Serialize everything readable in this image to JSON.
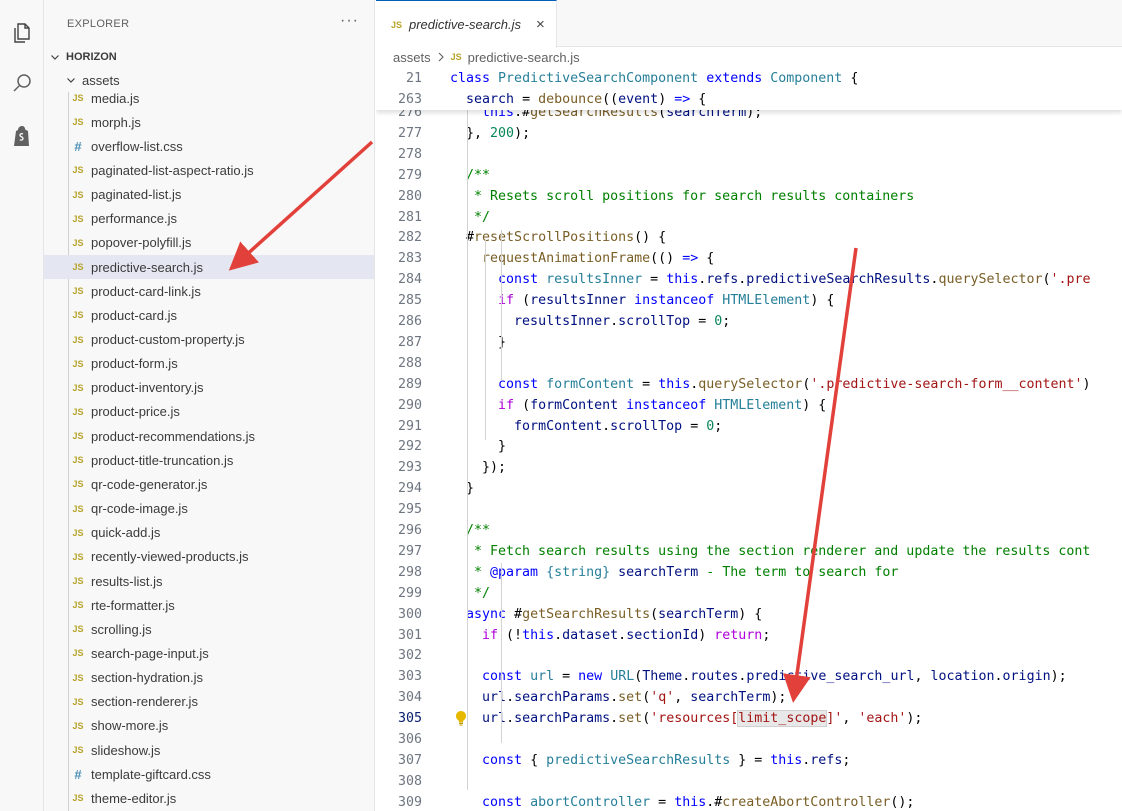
{
  "sidebar": {
    "title": "EXPLORER",
    "more": "···",
    "root": "HORIZON",
    "folder": "assets",
    "files": [
      {
        "name": "media.js",
        "type": "JS"
      },
      {
        "name": "morph.js",
        "type": "JS"
      },
      {
        "name": "overflow-list.css",
        "type": "#"
      },
      {
        "name": "paginated-list-aspect-ratio.js",
        "type": "JS"
      },
      {
        "name": "paginated-list.js",
        "type": "JS"
      },
      {
        "name": "performance.js",
        "type": "JS"
      },
      {
        "name": "popover-polyfill.js",
        "type": "JS"
      },
      {
        "name": "predictive-search.js",
        "type": "JS",
        "selected": true
      },
      {
        "name": "product-card-link.js",
        "type": "JS"
      },
      {
        "name": "product-card.js",
        "type": "JS"
      },
      {
        "name": "product-custom-property.js",
        "type": "JS"
      },
      {
        "name": "product-form.js",
        "type": "JS"
      },
      {
        "name": "product-inventory.js",
        "type": "JS"
      },
      {
        "name": "product-price.js",
        "type": "JS"
      },
      {
        "name": "product-recommendations.js",
        "type": "JS"
      },
      {
        "name": "product-title-truncation.js",
        "type": "JS"
      },
      {
        "name": "qr-code-generator.js",
        "type": "JS"
      },
      {
        "name": "qr-code-image.js",
        "type": "JS"
      },
      {
        "name": "quick-add.js",
        "type": "JS"
      },
      {
        "name": "recently-viewed-products.js",
        "type": "JS"
      },
      {
        "name": "results-list.js",
        "type": "JS"
      },
      {
        "name": "rte-formatter.js",
        "type": "JS"
      },
      {
        "name": "scrolling.js",
        "type": "JS"
      },
      {
        "name": "search-page-input.js",
        "type": "JS"
      },
      {
        "name": "section-hydration.js",
        "type": "JS"
      },
      {
        "name": "section-renderer.js",
        "type": "JS"
      },
      {
        "name": "show-more.js",
        "type": "JS"
      },
      {
        "name": "slideshow.js",
        "type": "JS"
      },
      {
        "name": "template-giftcard.css",
        "type": "#"
      },
      {
        "name": "theme-editor.js",
        "type": "JS"
      }
    ]
  },
  "editor": {
    "tab": {
      "icon": "JS",
      "label": "predictive-search.js",
      "close": "×"
    },
    "breadcrumb": {
      "folder": "assets",
      "icon": "JS",
      "file": "predictive-search.js"
    },
    "sticky_lines": [
      {
        "num": "21",
        "segs": [
          {
            "t": "class ",
            "c": "kw"
          },
          {
            "t": "PredictiveSearchComponent",
            "c": "ty"
          },
          {
            "t": " ",
            "c": ""
          },
          {
            "t": "extends",
            "c": "kw"
          },
          {
            "t": " ",
            "c": ""
          },
          {
            "t": "Component",
            "c": "ty"
          },
          {
            "t": " {",
            "c": ""
          }
        ]
      },
      {
        "num": "263",
        "segs": [
          {
            "t": "  ",
            "c": ""
          },
          {
            "t": "search",
            "c": "vr"
          },
          {
            "t": " = ",
            "c": ""
          },
          {
            "t": "debounce",
            "c": "fn"
          },
          {
            "t": "((",
            "c": ""
          },
          {
            "t": "event",
            "c": "vr"
          },
          {
            "t": ") ",
            "c": ""
          },
          {
            "t": "=>",
            "c": "kw"
          },
          {
            "t": " {",
            "c": ""
          }
        ]
      }
    ],
    "lines": [
      {
        "num": "276",
        "segs": [
          {
            "t": "    ",
            "c": ""
          },
          {
            "t": "this",
            "c": "kw"
          },
          {
            "t": ".#",
            "c": ""
          },
          {
            "t": "getSearchResults",
            "c": "fn"
          },
          {
            "t": "(",
            "c": ""
          },
          {
            "t": "searchTerm",
            "c": "vr"
          },
          {
            "t": ");",
            "c": ""
          }
        ]
      },
      {
        "num": "277",
        "segs": [
          {
            "t": "  }, ",
            "c": ""
          },
          {
            "t": "200",
            "c": "num"
          },
          {
            "t": ");",
            "c": ""
          }
        ]
      },
      {
        "num": "278",
        "segs": []
      },
      {
        "num": "279",
        "segs": [
          {
            "t": "  /**",
            "c": "cm"
          }
        ]
      },
      {
        "num": "280",
        "segs": [
          {
            "t": "   * Resets scroll positions for search results containers",
            "c": "cm"
          }
        ]
      },
      {
        "num": "281",
        "segs": [
          {
            "t": "   */",
            "c": "cm"
          }
        ]
      },
      {
        "num": "282",
        "segs": [
          {
            "t": "  #",
            "c": ""
          },
          {
            "t": "resetScrollPositions",
            "c": "fn"
          },
          {
            "t": "() {",
            "c": ""
          }
        ]
      },
      {
        "num": "283",
        "segs": [
          {
            "t": "    ",
            "c": ""
          },
          {
            "t": "requestAnimationFrame",
            "c": "fn"
          },
          {
            "t": "(() ",
            "c": ""
          },
          {
            "t": "=>",
            "c": "kw"
          },
          {
            "t": " {",
            "c": ""
          }
        ]
      },
      {
        "num": "284",
        "segs": [
          {
            "t": "      ",
            "c": ""
          },
          {
            "t": "const",
            "c": "kw"
          },
          {
            "t": " ",
            "c": ""
          },
          {
            "t": "resultsInner",
            "c": "ty"
          },
          {
            "t": " = ",
            "c": ""
          },
          {
            "t": "this",
            "c": "kw"
          },
          {
            "t": ".",
            "c": ""
          },
          {
            "t": "refs",
            "c": "vr"
          },
          {
            "t": ".",
            "c": ""
          },
          {
            "t": "predictiveSearchResults",
            "c": "vr"
          },
          {
            "t": ".",
            "c": ""
          },
          {
            "t": "querySelector",
            "c": "fn"
          },
          {
            "t": "(",
            "c": ""
          },
          {
            "t": "'.pre",
            "c": "str"
          }
        ]
      },
      {
        "num": "285",
        "segs": [
          {
            "t": "      ",
            "c": ""
          },
          {
            "t": "if",
            "c": "kc"
          },
          {
            "t": " (",
            "c": ""
          },
          {
            "t": "resultsInner",
            "c": "vr"
          },
          {
            "t": " ",
            "c": ""
          },
          {
            "t": "instanceof",
            "c": "kw"
          },
          {
            "t": " ",
            "c": ""
          },
          {
            "t": "HTMLElement",
            "c": "ty"
          },
          {
            "t": ") {",
            "c": ""
          }
        ]
      },
      {
        "num": "286",
        "segs": [
          {
            "t": "        ",
            "c": ""
          },
          {
            "t": "resultsInner",
            "c": "vr"
          },
          {
            "t": ".",
            "c": ""
          },
          {
            "t": "scrollTop",
            "c": "vr"
          },
          {
            "t": " = ",
            "c": ""
          },
          {
            "t": "0",
            "c": "num"
          },
          {
            "t": ";",
            "c": ""
          }
        ]
      },
      {
        "num": "287",
        "segs": [
          {
            "t": "      }",
            "c": ""
          }
        ]
      },
      {
        "num": "288",
        "segs": []
      },
      {
        "num": "289",
        "segs": [
          {
            "t": "      ",
            "c": ""
          },
          {
            "t": "const",
            "c": "kw"
          },
          {
            "t": " ",
            "c": ""
          },
          {
            "t": "formContent",
            "c": "ty"
          },
          {
            "t": " = ",
            "c": ""
          },
          {
            "t": "this",
            "c": "kw"
          },
          {
            "t": ".",
            "c": ""
          },
          {
            "t": "querySelector",
            "c": "fn"
          },
          {
            "t": "(",
            "c": ""
          },
          {
            "t": "'.predictive-search-form__content'",
            "c": "str"
          },
          {
            "t": ")",
            "c": ""
          }
        ]
      },
      {
        "num": "290",
        "segs": [
          {
            "t": "      ",
            "c": ""
          },
          {
            "t": "if",
            "c": "kc"
          },
          {
            "t": " (",
            "c": ""
          },
          {
            "t": "formContent",
            "c": "vr"
          },
          {
            "t": " ",
            "c": ""
          },
          {
            "t": "instanceof",
            "c": "kw"
          },
          {
            "t": " ",
            "c": ""
          },
          {
            "t": "HTMLElement",
            "c": "ty"
          },
          {
            "t": ") {",
            "c": ""
          }
        ]
      },
      {
        "num": "291",
        "segs": [
          {
            "t": "        ",
            "c": ""
          },
          {
            "t": "formContent",
            "c": "vr"
          },
          {
            "t": ".",
            "c": ""
          },
          {
            "t": "scrollTop",
            "c": "vr"
          },
          {
            "t": " = ",
            "c": ""
          },
          {
            "t": "0",
            "c": "num"
          },
          {
            "t": ";",
            "c": ""
          }
        ]
      },
      {
        "num": "292",
        "segs": [
          {
            "t": "      }",
            "c": ""
          }
        ]
      },
      {
        "num": "293",
        "segs": [
          {
            "t": "    });",
            "c": ""
          }
        ]
      },
      {
        "num": "294",
        "segs": [
          {
            "t": "  }",
            "c": ""
          }
        ]
      },
      {
        "num": "295",
        "segs": []
      },
      {
        "num": "296",
        "segs": [
          {
            "t": "  /**",
            "c": "cm"
          }
        ]
      },
      {
        "num": "297",
        "segs": [
          {
            "t": "   * Fetch search results using the section renderer and update the results cont",
            "c": "cm"
          }
        ]
      },
      {
        "num": "298",
        "segs": [
          {
            "t": "   * ",
            "c": "cm"
          },
          {
            "t": "@param",
            "c": "kw"
          },
          {
            "t": " ",
            "c": "cm"
          },
          {
            "t": "{string}",
            "c": "ty"
          },
          {
            "t": " ",
            "c": "cm"
          },
          {
            "t": "searchTerm",
            "c": "vr"
          },
          {
            "t": " - The term to search for",
            "c": "cm"
          }
        ]
      },
      {
        "num": "299",
        "segs": [
          {
            "t": "   */",
            "c": "cm"
          }
        ]
      },
      {
        "num": "300",
        "segs": [
          {
            "t": "  ",
            "c": ""
          },
          {
            "t": "async",
            "c": "kw"
          },
          {
            "t": " #",
            "c": ""
          },
          {
            "t": "getSearchResults",
            "c": "fn"
          },
          {
            "t": "(",
            "c": ""
          },
          {
            "t": "searchTerm",
            "c": "vr"
          },
          {
            "t": ") {",
            "c": ""
          }
        ]
      },
      {
        "num": "301",
        "segs": [
          {
            "t": "    ",
            "c": ""
          },
          {
            "t": "if",
            "c": "kc"
          },
          {
            "t": " (!",
            "c": ""
          },
          {
            "t": "this",
            "c": "kw"
          },
          {
            "t": ".",
            "c": ""
          },
          {
            "t": "dataset",
            "c": "vr"
          },
          {
            "t": ".",
            "c": ""
          },
          {
            "t": "sectionId",
            "c": "vr"
          },
          {
            "t": ") ",
            "c": ""
          },
          {
            "t": "return",
            "c": "kc"
          },
          {
            "t": ";",
            "c": ""
          }
        ]
      },
      {
        "num": "302",
        "segs": []
      },
      {
        "num": "303",
        "segs": [
          {
            "t": "    ",
            "c": ""
          },
          {
            "t": "const",
            "c": "kw"
          },
          {
            "t": " ",
            "c": ""
          },
          {
            "t": "url",
            "c": "ty"
          },
          {
            "t": " = ",
            "c": ""
          },
          {
            "t": "new",
            "c": "kw"
          },
          {
            "t": " ",
            "c": ""
          },
          {
            "t": "URL",
            "c": "ty"
          },
          {
            "t": "(",
            "c": ""
          },
          {
            "t": "Theme",
            "c": "vr"
          },
          {
            "t": ".",
            "c": ""
          },
          {
            "t": "routes",
            "c": "vr"
          },
          {
            "t": ".",
            "c": ""
          },
          {
            "t": "predictive_search_url",
            "c": "vr"
          },
          {
            "t": ", ",
            "c": ""
          },
          {
            "t": "location",
            "c": "vr"
          },
          {
            "t": ".",
            "c": ""
          },
          {
            "t": "origin",
            "c": "vr"
          },
          {
            "t": ");",
            "c": ""
          }
        ]
      },
      {
        "num": "304",
        "segs": [
          {
            "t": "    ",
            "c": ""
          },
          {
            "t": "url",
            "c": "vr"
          },
          {
            "t": ".",
            "c": ""
          },
          {
            "t": "searchParams",
            "c": "vr"
          },
          {
            "t": ".",
            "c": ""
          },
          {
            "t": "set",
            "c": "fn"
          },
          {
            "t": "(",
            "c": ""
          },
          {
            "t": "'q'",
            "c": "str"
          },
          {
            "t": ", ",
            "c": ""
          },
          {
            "t": "searchTerm",
            "c": "vr"
          },
          {
            "t": ");",
            "c": ""
          }
        ]
      },
      {
        "num": "305",
        "active": true,
        "segs": [
          {
            "t": "    ",
            "c": ""
          },
          {
            "t": "url",
            "c": "vr"
          },
          {
            "t": ".",
            "c": ""
          },
          {
            "t": "searchParams",
            "c": "vr"
          },
          {
            "t": ".",
            "c": ""
          },
          {
            "t": "set",
            "c": "fn"
          },
          {
            "t": "(",
            "c": ""
          },
          {
            "t": "'resources[",
            "c": "str"
          },
          {
            "t": "limit_scope",
            "c": "str hl"
          },
          {
            "t": "]'",
            "c": "str"
          },
          {
            "t": ", ",
            "c": ""
          },
          {
            "t": "'each'",
            "c": "str"
          },
          {
            "t": ");",
            "c": ""
          }
        ]
      },
      {
        "num": "306",
        "segs": []
      },
      {
        "num": "307",
        "segs": [
          {
            "t": "    ",
            "c": ""
          },
          {
            "t": "const",
            "c": "kw"
          },
          {
            "t": " { ",
            "c": ""
          },
          {
            "t": "predictiveSearchResults",
            "c": "ty"
          },
          {
            "t": " } = ",
            "c": ""
          },
          {
            "t": "this",
            "c": "kw"
          },
          {
            "t": ".",
            "c": ""
          },
          {
            "t": "refs",
            "c": "vr"
          },
          {
            "t": ";",
            "c": ""
          }
        ]
      },
      {
        "num": "308",
        "segs": []
      },
      {
        "num": "309",
        "segs": [
          {
            "t": "    ",
            "c": ""
          },
          {
            "t": "const",
            "c": "kw"
          },
          {
            "t": " ",
            "c": ""
          },
          {
            "t": "abortController",
            "c": "ty"
          },
          {
            "t": " = ",
            "c": ""
          },
          {
            "t": "this",
            "c": "kw"
          },
          {
            "t": ".#",
            "c": ""
          },
          {
            "t": "createAbortController",
            "c": "fn"
          },
          {
            "t": "();",
            "c": ""
          }
        ]
      }
    ]
  },
  "colors": {
    "accent": "#005fb8",
    "annotation_arrow": "#e2403a",
    "selected_row": "#e4e6f1"
  },
  "icons": [
    "explorer-files-icon",
    "search-icon",
    "shopify-bag-icon",
    "chevron-down-icon",
    "chevron-right-icon",
    "lightbulb-icon"
  ]
}
